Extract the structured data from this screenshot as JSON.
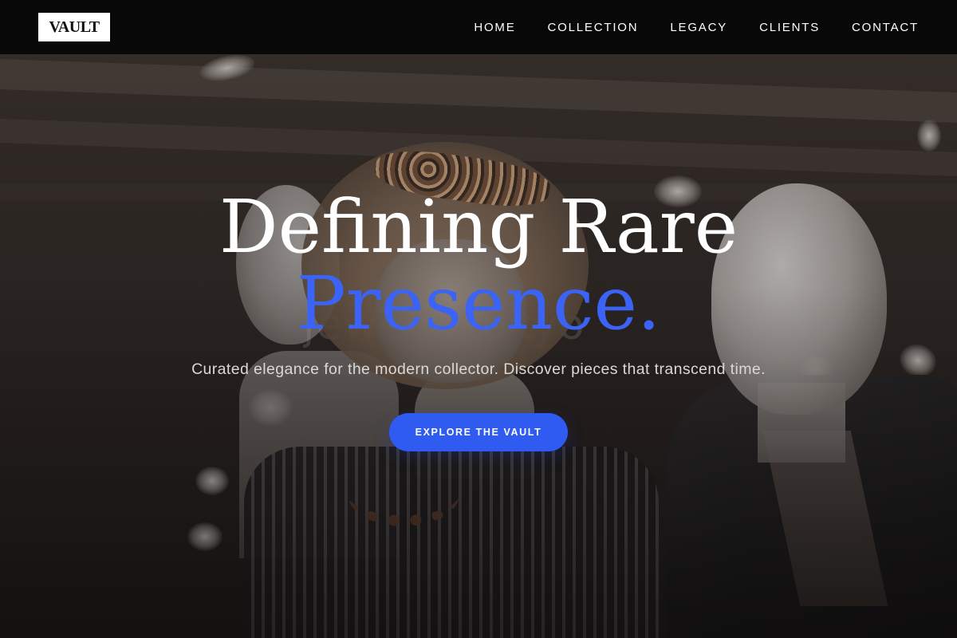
{
  "header": {
    "logo": "VAULT",
    "nav": [
      {
        "label": "HOME"
      },
      {
        "label": "COLLECTION"
      },
      {
        "label": "LEGACY"
      },
      {
        "label": "CLIENTS"
      },
      {
        "label": "CONTACT"
      }
    ]
  },
  "hero": {
    "headline_line_1": "Defining Rare",
    "headline_line_2": "Presence.",
    "subtitle": "Curated elegance for the modern collector. Discover pieces that transcend time.",
    "cta_label": "EXPLORE THE VAULT",
    "background_watermark": "jewelrytokyo"
  },
  "colors": {
    "accent": "#2f5bf0",
    "headline_accent": "#3b63f6",
    "navbar_bg": "#060606",
    "logo_bg": "#ffffff",
    "text_primary": "#ffffff"
  },
  "icons": []
}
